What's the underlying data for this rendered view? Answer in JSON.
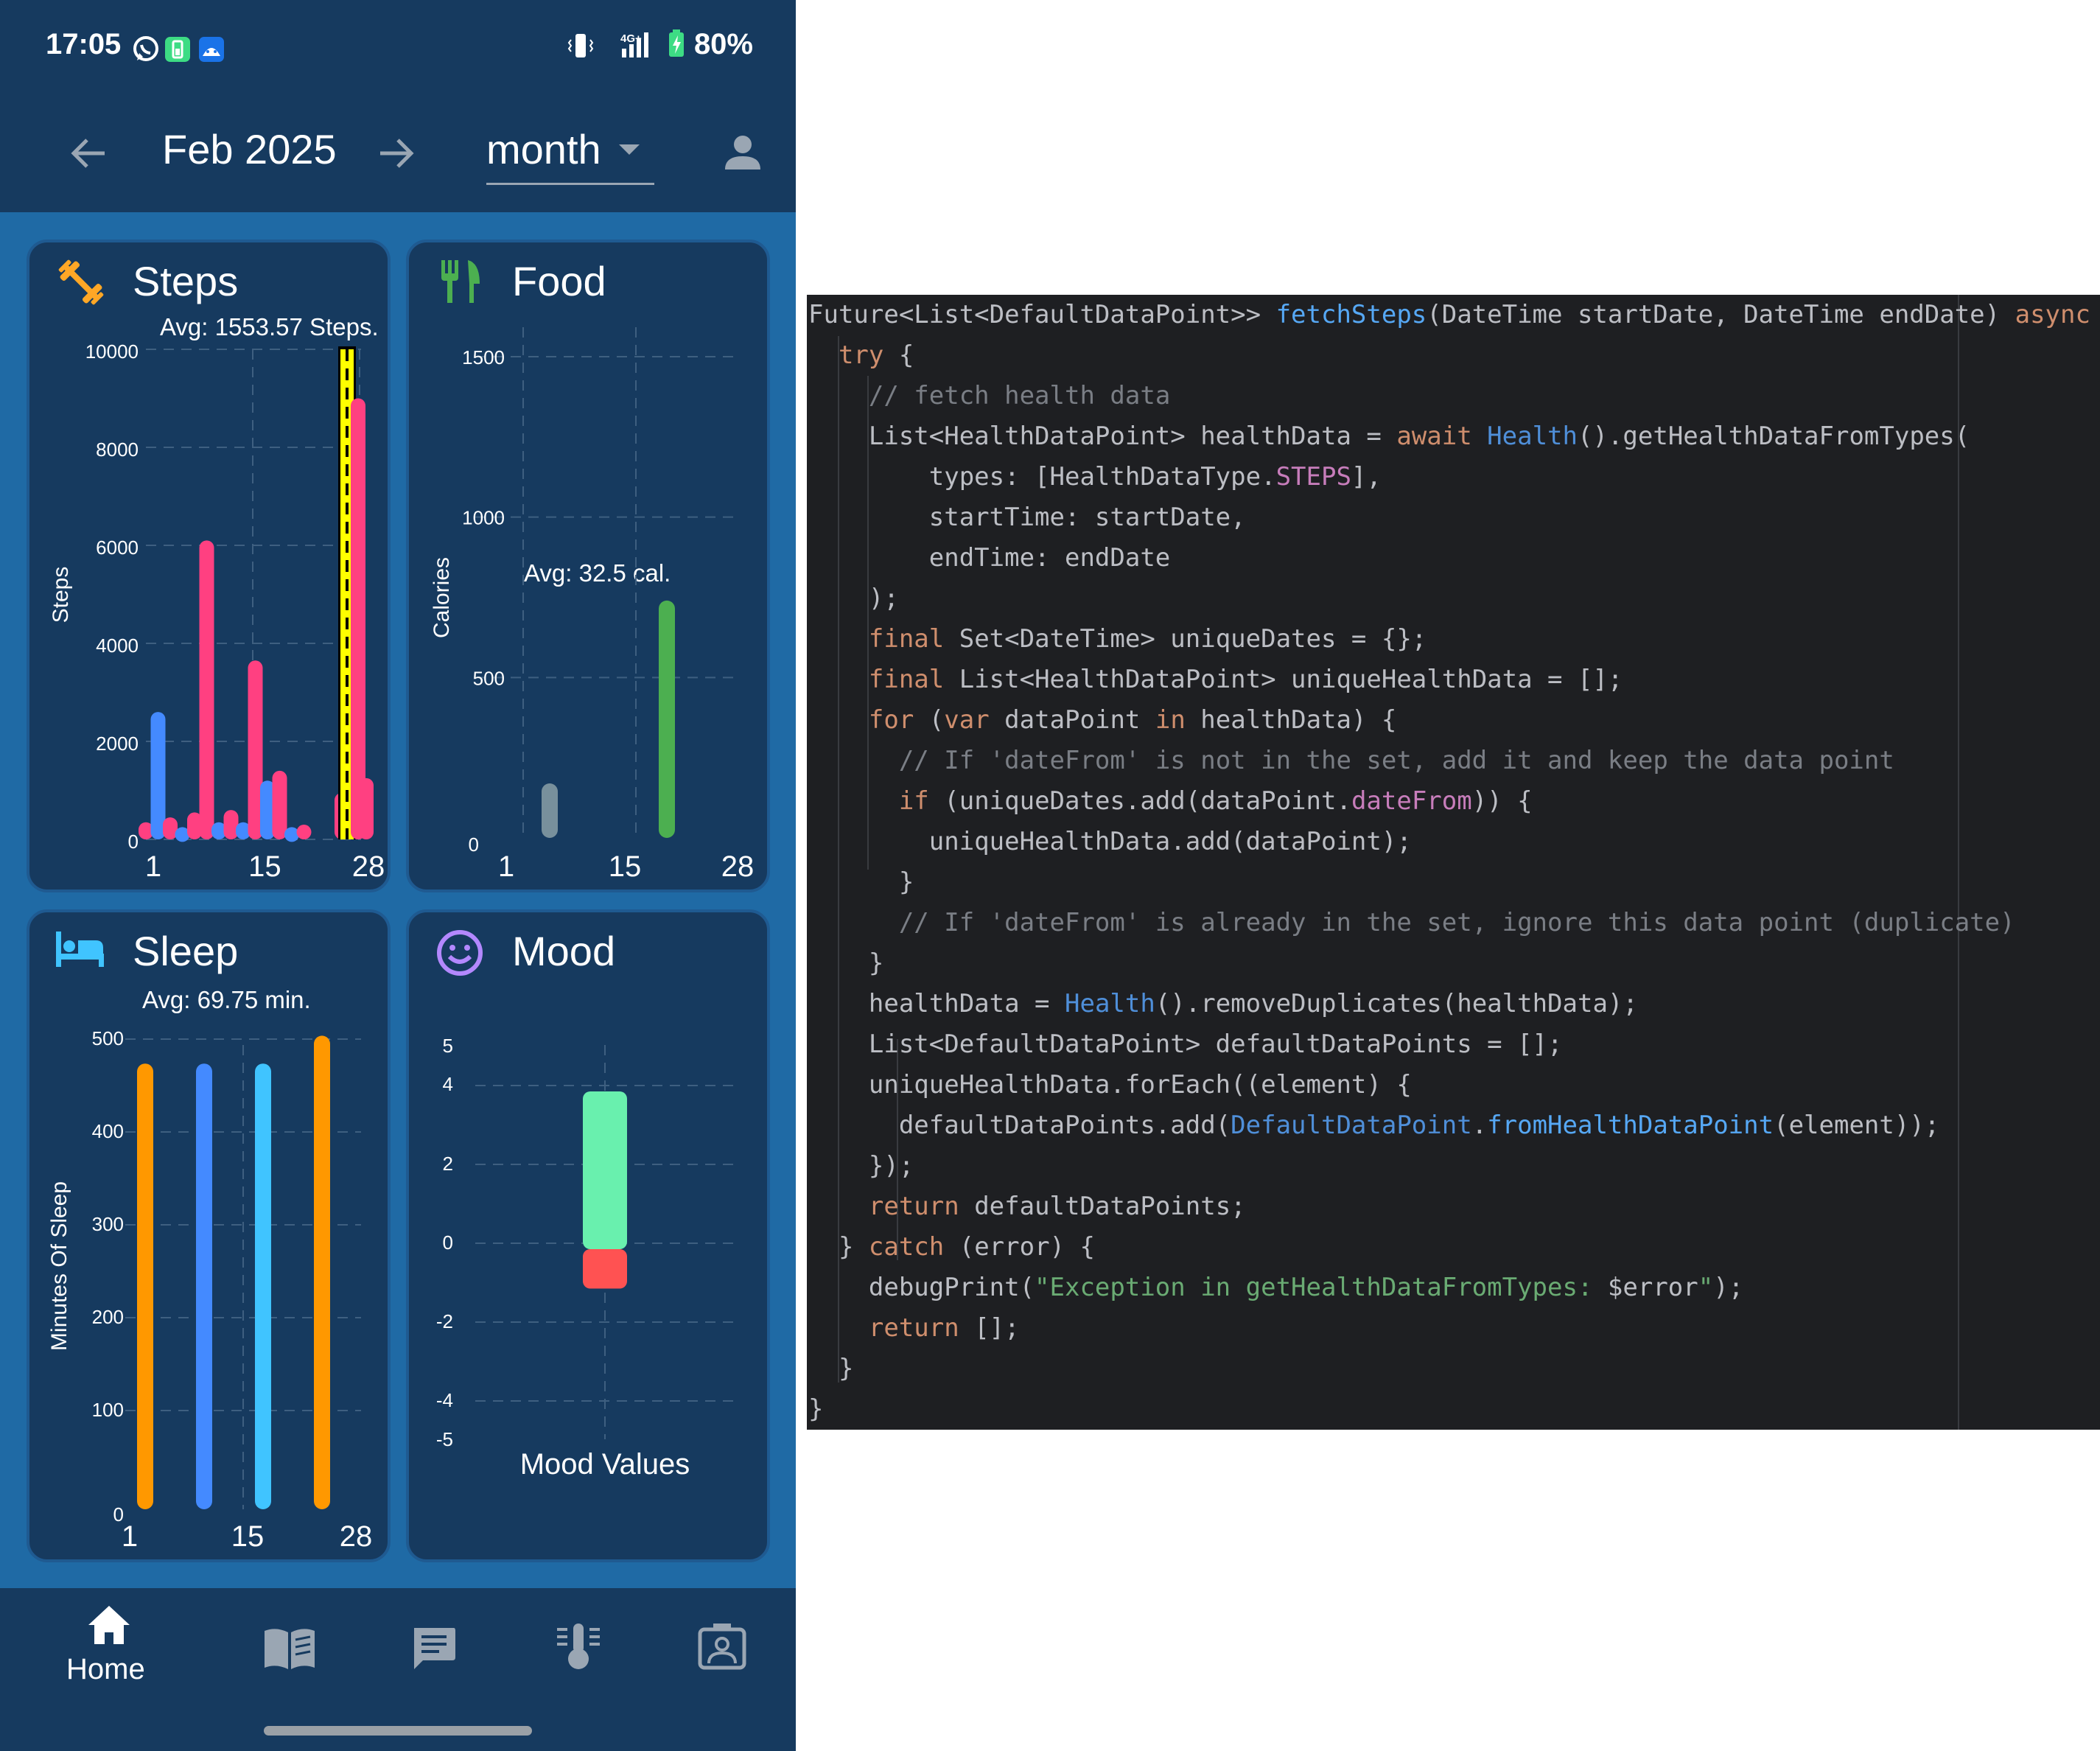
{
  "status_bar": {
    "time": "17:05",
    "network": "4G+",
    "battery": "80%",
    "icons": [
      "whatsapp-icon",
      "battery-app-icon",
      "android-icon",
      "vibrate-icon",
      "signal-icon",
      "battery-charging-icon"
    ]
  },
  "header": {
    "prev_icon": "arrow-left-icon",
    "title": "Feb 2025",
    "next_icon": "arrow-right-icon",
    "period": "month",
    "profile_icon": "person-icon"
  },
  "cards": {
    "steps": {
      "title": "Steps",
      "icon": "fitness-icon",
      "avg": "Avg: 1553.57 Steps.",
      "ylabel": "Steps",
      "yticks": [
        "10000",
        "8000",
        "6000",
        "4000",
        "2000",
        "0"
      ],
      "xticks": [
        "1",
        "15",
        "28"
      ]
    },
    "food": {
      "title": "Food",
      "icon": "restaurant-icon",
      "avg": "Avg: 32.5 cal.",
      "ylabel": "Calories",
      "yticks": [
        "1500",
        "1000",
        "500",
        "0"
      ],
      "xticks": [
        "1",
        "15",
        "28"
      ]
    },
    "sleep": {
      "title": "Sleep",
      "icon": "bed-icon",
      "avg": "Avg: 69.75 min.",
      "ylabel": "Minutes Of Sleep",
      "yticks": [
        "500",
        "400",
        "300",
        "200",
        "100",
        "0"
      ],
      "xticks": [
        "1",
        "15",
        "28"
      ]
    },
    "mood": {
      "title": "Mood",
      "icon": "smiley-icon",
      "yticks": [
        "5",
        "4",
        "2",
        "0",
        "-2",
        "-4",
        "-5"
      ],
      "xlabel": "Mood Values"
    }
  },
  "chart_data": [
    {
      "type": "bar",
      "name": "Steps",
      "ylabel": "Steps",
      "ylim": [
        0,
        10000
      ],
      "x_ticks": [
        "1",
        "15",
        "28"
      ],
      "avg_label": "Avg: 1553.57 Steps.",
      "bars": [
        {
          "day": 1,
          "value": 350,
          "color": "#ff4081"
        },
        {
          "day": 2,
          "value": 2600,
          "color": "#448aff"
        },
        {
          "day": 3,
          "value": 450,
          "color": "#ff4081"
        },
        {
          "day": 4,
          "value": 250,
          "color": "#448aff"
        },
        {
          "day": 5,
          "value": 550,
          "color": "#ff4081"
        },
        {
          "day": 6,
          "value": 6100,
          "color": "#ff4081"
        },
        {
          "day": 7,
          "value": 350,
          "color": "#448aff"
        },
        {
          "day": 8,
          "value": 600,
          "color": "#ff4081"
        },
        {
          "day": 9,
          "value": 350,
          "color": "#448aff"
        },
        {
          "day": 10,
          "value": 3650,
          "color": "#ff4081"
        },
        {
          "day": 11,
          "value": 1200,
          "color": "#448aff"
        },
        {
          "day": 12,
          "value": 1400,
          "color": "#ff4081"
        },
        {
          "day": 13,
          "value": 250,
          "color": "#448aff"
        },
        {
          "day": 14,
          "value": 300,
          "color": "#ff4081"
        },
        {
          "day": 15,
          "value": 950,
          "color": "#ff4081"
        },
        {
          "day": 16,
          "value": 500,
          "color": "#448aff"
        },
        {
          "day": 17,
          "value": 1250,
          "color": "#ff4081"
        },
        {
          "day": 18,
          "value": 10000,
          "color": "#ffff00",
          "highlight": true
        },
        {
          "day": 19,
          "value": 9000,
          "color": "#ff4081"
        }
      ]
    },
    {
      "type": "bar",
      "name": "Food",
      "ylabel": "Calories",
      "ylim": [
        0,
        1500
      ],
      "x_ticks": [
        "1",
        "15",
        "28"
      ],
      "avg_label": "Avg: 32.5 cal.",
      "bars": [
        {
          "day": 5,
          "value": 170,
          "color": "#78909c"
        },
        {
          "day": 22,
          "value": 740,
          "color": "#4caf50"
        }
      ]
    },
    {
      "type": "bar",
      "name": "Sleep",
      "ylabel": "Minutes Of Sleep",
      "ylim": [
        0,
        500
      ],
      "x_ticks": [
        "1",
        "15",
        "28"
      ],
      "avg_label": "Avg: 69.75 min.",
      "bars": [
        {
          "day": 4,
          "value": 480,
          "color": "#ff9800"
        },
        {
          "day": 11,
          "value": 480,
          "color": "#448aff"
        },
        {
          "day": 18,
          "value": 480,
          "color": "#40c4ff"
        },
        {
          "day": 25,
          "value": 510,
          "color": "#ff9800"
        }
      ]
    },
    {
      "type": "bar",
      "name": "Mood",
      "xlabel": "Mood Values",
      "ylim": [
        -5,
        5
      ],
      "yticks": [
        5,
        4,
        2,
        0,
        -2,
        -4,
        -5
      ],
      "bars": [
        {
          "from": 0,
          "to": 4,
          "color": "#69f0ae"
        },
        {
          "from": -1,
          "to": 0,
          "color": "#ff5252"
        }
      ]
    }
  ],
  "bottom_nav": {
    "items": [
      {
        "label": "Home",
        "icon": "home-icon"
      },
      {
        "label": "",
        "icon": "journal-icon"
      },
      {
        "label": "",
        "icon": "chat-icon"
      },
      {
        "label": "",
        "icon": "thermometer-icon"
      },
      {
        "label": "",
        "icon": "profile-card-icon"
      }
    ]
  },
  "code": {
    "lines": [
      [
        {
          "t": "Future<List<DefaultDataPoint>> "
        },
        {
          "t": "fetchSteps",
          "c": "fn"
        },
        {
          "t": "(DateTime startDate, DateTime endDate) "
        },
        {
          "t": "async",
          "c": "kw"
        },
        {
          "t": " {"
        }
      ],
      [
        {
          "t": "  "
        },
        {
          "t": "try",
          "c": "kw"
        },
        {
          "t": " {"
        }
      ],
      [
        {
          "t": "    "
        },
        {
          "t": "// fetch health data",
          "c": "cm"
        }
      ],
      [
        {
          "t": "    List<HealthDataPoint> healthData = "
        },
        {
          "t": "await",
          "c": "kw"
        },
        {
          "t": " "
        },
        {
          "t": "Health",
          "c": "cls"
        },
        {
          "t": "().getHealthDataFromTypes("
        }
      ],
      [
        {
          "t": "        types: [HealthDataType."
        },
        {
          "t": "STEPS",
          "c": "fld"
        },
        {
          "t": "],"
        }
      ],
      [
        {
          "t": "        startTime: startDate,"
        }
      ],
      [
        {
          "t": "        endTime: endDate"
        }
      ],
      [
        {
          "t": "    );"
        }
      ],
      [
        {
          "t": "    "
        },
        {
          "t": "final",
          "c": "kw"
        },
        {
          "t": " Set<DateTime> uniqueDates = {};"
        }
      ],
      [
        {
          "t": "    "
        },
        {
          "t": "final",
          "c": "kw"
        },
        {
          "t": " List<HealthDataPoint> uniqueHealthData = [];"
        }
      ],
      [
        {
          "t": "    "
        },
        {
          "t": "for",
          "c": "kw"
        },
        {
          "t": " ("
        },
        {
          "t": "var",
          "c": "kw"
        },
        {
          "t": " dataPoint "
        },
        {
          "t": "in",
          "c": "kw"
        },
        {
          "t": " healthData) {"
        }
      ],
      [
        {
          "t": "      "
        },
        {
          "t": "// If 'dateFrom' is not in the set, add it and keep the data point",
          "c": "cm"
        }
      ],
      [
        {
          "t": "      "
        },
        {
          "t": "if",
          "c": "kw"
        },
        {
          "t": " (uniqueDates.add(dataPoint."
        },
        {
          "t": "dateFrom",
          "c": "fld"
        },
        {
          "t": ")) {"
        }
      ],
      [
        {
          "t": "        uniqueHealthData.add(dataPoint);"
        }
      ],
      [
        {
          "t": "      }"
        }
      ],
      [
        {
          "t": "      "
        },
        {
          "t": "// If 'dateFrom' is already in the set, ignore this data point (duplicate)",
          "c": "cm"
        }
      ],
      [
        {
          "t": "    }"
        }
      ],
      [
        {
          "t": "    healthData = "
        },
        {
          "t": "Health",
          "c": "cls"
        },
        {
          "t": "().removeDuplicates(healthData);"
        }
      ],
      [
        {
          "t": "    List<DefaultDataPoint> defaultDataPoints = [];"
        }
      ],
      [
        {
          "t": "    uniqueHealthData.forEach((element) {"
        }
      ],
      [
        {
          "t": "      defaultDataPoints.add("
        },
        {
          "t": "DefaultDataPoint",
          "c": "cls"
        },
        {
          "t": "."
        },
        {
          "t": "fromHealthDataPoint",
          "c": "fn"
        },
        {
          "t": "(element));"
        }
      ],
      [
        {
          "t": "    });"
        }
      ],
      [
        {
          "t": "    "
        },
        {
          "t": "return",
          "c": "kw"
        },
        {
          "t": " defaultDataPoints;"
        }
      ],
      [
        {
          "t": "  } "
        },
        {
          "t": "catch",
          "c": "kw"
        },
        {
          "t": " (error) {"
        }
      ],
      [
        {
          "t": "    debugPrint("
        },
        {
          "t": "\"Exception in getHealthDataFromTypes: ",
          "c": "str"
        },
        {
          "t": "$error"
        },
        {
          "t": "\"",
          "c": "str"
        },
        {
          "t": ");"
        }
      ],
      [
        {
          "t": "    "
        },
        {
          "t": "return",
          "c": "kw"
        },
        {
          "t": " [];"
        }
      ],
      [
        {
          "t": "  }"
        }
      ],
      [
        {
          "t": "}"
        }
      ]
    ]
  }
}
